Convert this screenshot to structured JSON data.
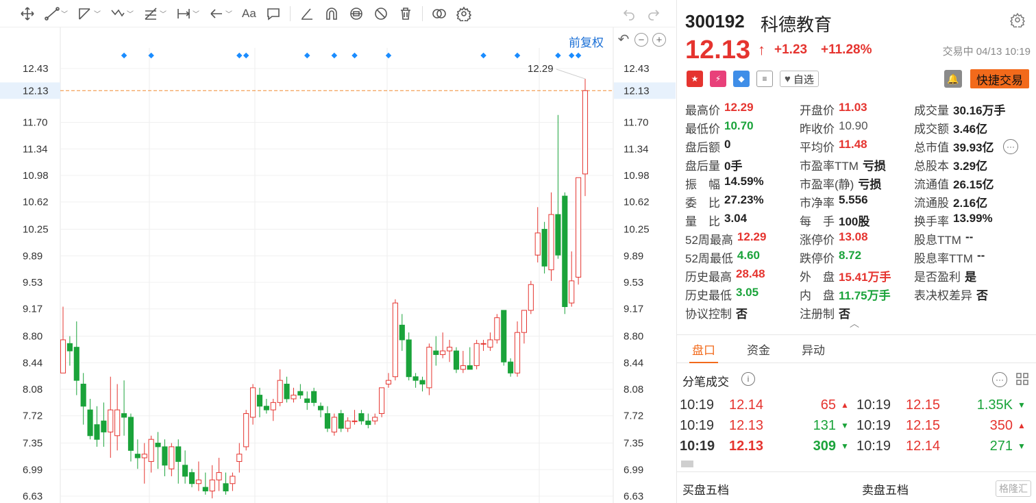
{
  "toolbar": {
    "items": [
      "move",
      "trend-line",
      "polyline",
      "wave",
      "fib",
      "measure",
      "arrow",
      "text",
      "comment",
      "pencil",
      "magnet",
      "lock",
      "hide",
      "delete",
      "compare",
      "settings"
    ],
    "text_label": "Aa"
  },
  "chart": {
    "adjust_label": "前复权",
    "y_ticks": [
      "12.43",
      "12.13",
      "11.70",
      "11.34",
      "10.98",
      "10.62",
      "10.25",
      "9.89",
      "9.53",
      "9.17",
      "8.80",
      "8.44",
      "8.08",
      "7.72",
      "7.35",
      "6.99",
      "6.63"
    ],
    "current_price_label": "12.13",
    "high_label": "12.29",
    "low_label": "6.63",
    "current_line_color": "#f08a30",
    "up_color": "#e5342f",
    "down_color": "#1aa33a",
    "marker_color": "#1a8cff"
  },
  "chart_data": {
    "type": "candlestick",
    "ylim": [
      6.63,
      12.43
    ],
    "candles": [
      {
        "o": 8.3,
        "h": 9.2,
        "l": 8.3,
        "c": 8.75
      },
      {
        "o": 8.7,
        "h": 8.8,
        "l": 8.4,
        "c": 8.6
      },
      {
        "o": 8.65,
        "h": 9.0,
        "l": 8.0,
        "c": 8.2
      },
      {
        "o": 8.15,
        "h": 8.3,
        "l": 7.6,
        "c": 7.85
      },
      {
        "o": 7.8,
        "h": 7.95,
        "l": 7.4,
        "c": 7.45
      },
      {
        "o": 7.6,
        "h": 7.85,
        "l": 7.3,
        "c": 7.4
      },
      {
        "o": 7.65,
        "h": 7.9,
        "l": 7.3,
        "c": 7.5
      },
      {
        "o": 7.5,
        "h": 8.25,
        "l": 7.15,
        "c": 7.8
      },
      {
        "o": 7.45,
        "h": 8.15,
        "l": 7.25,
        "c": 7.8
      },
      {
        "o": 7.75,
        "h": 8.2,
        "l": 7.45,
        "c": 7.7
      },
      {
        "o": 7.7,
        "h": 7.75,
        "l": 7.1,
        "c": 7.25
      },
      {
        "o": 7.2,
        "h": 7.4,
        "l": 7.0,
        "c": 7.15
      },
      {
        "o": 7.15,
        "h": 7.35,
        "l": 6.8,
        "c": 7.2
      },
      {
        "o": 7.1,
        "h": 7.45,
        "l": 6.95,
        "c": 7.4
      },
      {
        "o": 7.35,
        "h": 7.5,
        "l": 7.0,
        "c": 7.3
      },
      {
        "o": 7.3,
        "h": 7.4,
        "l": 6.9,
        "c": 7.05
      },
      {
        "o": 7.0,
        "h": 7.35,
        "l": 6.9,
        "c": 7.3
      },
      {
        "o": 7.3,
        "h": 7.4,
        "l": 6.8,
        "c": 7.1
      },
      {
        "o": 7.05,
        "h": 7.25,
        "l": 6.8,
        "c": 6.9
      },
      {
        "o": 6.95,
        "h": 7.0,
        "l": 6.75,
        "c": 6.8
      },
      {
        "o": 6.8,
        "h": 7.1,
        "l": 6.7,
        "c": 6.85
      },
      {
        "o": 6.75,
        "h": 6.95,
        "l": 6.65,
        "c": 6.7
      },
      {
        "o": 6.7,
        "h": 7.05,
        "l": 6.6,
        "c": 6.85
      },
      {
        "o": 6.85,
        "h": 7.15,
        "l": 6.7,
        "c": 6.95
      },
      {
        "o": 6.8,
        "h": 6.95,
        "l": 6.65,
        "c": 6.7
      },
      {
        "o": 6.8,
        "h": 6.95,
        "l": 6.7,
        "c": 6.9
      },
      {
        "o": 7.1,
        "h": 7.35,
        "l": 6.95,
        "c": 7.2
      },
      {
        "o": 7.3,
        "h": 7.8,
        "l": 7.25,
        "c": 7.75
      },
      {
        "o": 7.7,
        "h": 8.15,
        "l": 7.6,
        "c": 8.1
      },
      {
        "o": 8.0,
        "h": 8.1,
        "l": 7.7,
        "c": 7.85
      },
      {
        "o": 7.85,
        "h": 7.95,
        "l": 7.75,
        "c": 7.8
      },
      {
        "o": 7.8,
        "h": 7.95,
        "l": 7.65,
        "c": 7.9
      },
      {
        "o": 7.9,
        "h": 8.35,
        "l": 7.85,
        "c": 8.2
      },
      {
        "o": 8.15,
        "h": 8.25,
        "l": 7.9,
        "c": 7.95
      },
      {
        "o": 7.95,
        "h": 8.1,
        "l": 7.9,
        "c": 8.0
      },
      {
        "o": 8.05,
        "h": 8.15,
        "l": 7.95,
        "c": 8.0
      },
      {
        "o": 7.95,
        "h": 8.05,
        "l": 7.8,
        "c": 7.9
      },
      {
        "o": 8.05,
        "h": 8.1,
        "l": 7.85,
        "c": 7.9
      },
      {
        "o": 7.85,
        "h": 7.9,
        "l": 7.7,
        "c": 7.8
      },
      {
        "o": 7.75,
        "h": 7.85,
        "l": 7.5,
        "c": 7.55
      },
      {
        "o": 7.5,
        "h": 7.75,
        "l": 7.45,
        "c": 7.7
      },
      {
        "o": 7.75,
        "h": 7.8,
        "l": 7.5,
        "c": 7.55
      },
      {
        "o": 7.55,
        "h": 7.7,
        "l": 7.5,
        "c": 7.65
      },
      {
        "o": 7.65,
        "h": 7.8,
        "l": 7.6,
        "c": 7.65
      },
      {
        "o": 7.75,
        "h": 7.8,
        "l": 7.6,
        "c": 7.65
      },
      {
        "o": 7.65,
        "h": 7.75,
        "l": 7.55,
        "c": 7.6
      },
      {
        "o": 7.65,
        "h": 7.75,
        "l": 7.6,
        "c": 7.7
      },
      {
        "o": 7.75,
        "h": 8.1,
        "l": 7.7,
        "c": 8.1
      },
      {
        "o": 8.15,
        "h": 8.3,
        "l": 8.1,
        "c": 8.2
      },
      {
        "o": 8.25,
        "h": 9.3,
        "l": 8.2,
        "c": 9.25
      },
      {
        "o": 8.95,
        "h": 9.1,
        "l": 8.6,
        "c": 8.75
      },
      {
        "o": 8.75,
        "h": 8.85,
        "l": 8.2,
        "c": 8.25
      },
      {
        "o": 8.25,
        "h": 8.3,
        "l": 8.1,
        "c": 8.2
      },
      {
        "o": 8.2,
        "h": 8.25,
        "l": 8.05,
        "c": 8.15
      },
      {
        "o": 8.1,
        "h": 8.7,
        "l": 8.0,
        "c": 8.65
      },
      {
        "o": 8.6,
        "h": 8.8,
        "l": 8.4,
        "c": 8.55
      },
      {
        "o": 8.55,
        "h": 8.85,
        "l": 8.5,
        "c": 8.6
      },
      {
        "o": 8.6,
        "h": 8.75,
        "l": 8.45,
        "c": 8.65
      },
      {
        "o": 8.6,
        "h": 8.65,
        "l": 8.3,
        "c": 8.35
      },
      {
        "o": 8.35,
        "h": 8.6,
        "l": 8.3,
        "c": 8.4
      },
      {
        "o": 8.4,
        "h": 8.65,
        "l": 8.35,
        "c": 8.35
      },
      {
        "o": 8.4,
        "h": 8.75,
        "l": 8.35,
        "c": 8.7
      },
      {
        "o": 8.7,
        "h": 8.75,
        "l": 8.6,
        "c": 8.7
      },
      {
        "o": 8.65,
        "h": 8.85,
        "l": 8.6,
        "c": 8.75
      },
      {
        "o": 8.75,
        "h": 9.1,
        "l": 8.7,
        "c": 9.05
      },
      {
        "o": 9.15,
        "h": 9.15,
        "l": 8.4,
        "c": 8.45
      },
      {
        "o": 8.45,
        "h": 8.5,
        "l": 8.25,
        "c": 8.3
      },
      {
        "o": 8.3,
        "h": 9.0,
        "l": 8.25,
        "c": 8.85
      },
      {
        "o": 8.85,
        "h": 9.15,
        "l": 8.7,
        "c": 9.15
      },
      {
        "o": 9.15,
        "h": 9.55,
        "l": 9.1,
        "c": 9.5
      },
      {
        "o": 9.9,
        "h": 10.55,
        "l": 9.8,
        "c": 10.2
      },
      {
        "o": 10.25,
        "h": 10.35,
        "l": 9.65,
        "c": 9.75
      },
      {
        "o": 9.7,
        "h": 10.75,
        "l": 9.55,
        "c": 10.45
      },
      {
        "o": 10.45,
        "h": 11.8,
        "l": 9.85,
        "c": 9.9
      },
      {
        "o": 10.7,
        "h": 10.75,
        "l": 9.1,
        "c": 9.2
      },
      {
        "o": 9.25,
        "h": 9.95,
        "l": 9.2,
        "c": 9.55
      },
      {
        "o": 9.6,
        "h": 10.95,
        "l": 9.5,
        "c": 10.95
      },
      {
        "o": 11.0,
        "h": 12.29,
        "l": 10.7,
        "c": 12.13
      }
    ],
    "markers_x_index": [
      9,
      13,
      26,
      27,
      36,
      40,
      43,
      48,
      62,
      67,
      73,
      75,
      76
    ]
  },
  "stock": {
    "code": "300192",
    "name": "科德教育",
    "price": "12.13",
    "arrow": "↑",
    "change": "+1.23",
    "change_pct": "+11.28%",
    "status": "交易中 04/13 10:19",
    "watch_label": "自选",
    "quick_trade": "快捷交易"
  },
  "stats": [
    [
      {
        "l": "最高价",
        "v": "12.29",
        "c": "red"
      },
      {
        "l": "开盘价",
        "v": "11.03",
        "c": "red"
      },
      {
        "l": "成交量",
        "v": "30.16万手",
        "c": "dark"
      }
    ],
    [
      {
        "l": "最低价",
        "v": "10.70",
        "c": "green"
      },
      {
        "l": "昨收价",
        "v": "10.90",
        "c": "gray"
      },
      {
        "l": "成交额",
        "v": "3.46亿",
        "c": "dark"
      }
    ],
    [
      {
        "l": "盘后额",
        "v": "0",
        "c": "dark"
      },
      {
        "l": "平均价",
        "v": "11.48",
        "c": "red"
      },
      {
        "l": "总市值",
        "v": "39.93亿",
        "c": "dark"
      }
    ],
    [
      {
        "l": "盘后量",
        "v": "0手",
        "c": "dark"
      },
      {
        "l": "市盈率TTM",
        "v": "亏损",
        "c": "dark"
      },
      {
        "l": "总股本",
        "v": "3.29亿",
        "c": "dark"
      }
    ],
    [
      {
        "l": "振　幅",
        "v": "14.59%",
        "c": "dark"
      },
      {
        "l": "市盈率(静)",
        "v": "亏损",
        "c": "dark"
      },
      {
        "l": "流通值",
        "v": "26.15亿",
        "c": "dark"
      }
    ],
    [
      {
        "l": "委　比",
        "v": "27.23%",
        "c": "dark"
      },
      {
        "l": "市净率",
        "v": "5.556",
        "c": "dark"
      },
      {
        "l": "流通股",
        "v": "2.16亿",
        "c": "dark"
      }
    ],
    [
      {
        "l": "量　比",
        "v": "3.04",
        "c": "dark"
      },
      {
        "l": "每　手",
        "v": "100股",
        "c": "dark"
      },
      {
        "l": "换手率",
        "v": "13.99%",
        "c": "dark"
      }
    ],
    [
      {
        "l": "52周最高",
        "v": "12.29",
        "c": "red"
      },
      {
        "l": "涨停价",
        "v": "13.08",
        "c": "red"
      },
      {
        "l": "股息TTM",
        "v": "--",
        "c": "dark"
      }
    ],
    [
      {
        "l": "52周最低",
        "v": "4.60",
        "c": "green"
      },
      {
        "l": "跌停价",
        "v": "8.72",
        "c": "green"
      },
      {
        "l": "股息率TTM",
        "v": "--",
        "c": "dark"
      }
    ],
    [
      {
        "l": "历史最高",
        "v": "28.48",
        "c": "red"
      },
      {
        "l": "外　盘",
        "v": "15.41万手",
        "c": "red"
      },
      {
        "l": "是否盈利",
        "v": "是",
        "c": "dark"
      }
    ],
    [
      {
        "l": "历史最低",
        "v": "3.05",
        "c": "green"
      },
      {
        "l": "内　盘",
        "v": "11.75万手",
        "c": "green"
      },
      {
        "l": "表决权差异",
        "v": "否",
        "c": "dark"
      }
    ],
    [
      {
        "l": "协议控制",
        "v": "否",
        "c": "dark"
      },
      {
        "l": "注册制",
        "v": "否",
        "c": "dark"
      },
      {
        "l": "",
        "v": "",
        "c": "dark"
      }
    ]
  ],
  "tabs": [
    "盘口",
    "资金",
    "异动"
  ],
  "ticks": {
    "title": "分笔成交",
    "rows": [
      [
        {
          "t": "10:19",
          "p": "12.14",
          "v": "65",
          "vc": "red",
          "a": "up"
        },
        {
          "t": "10:19",
          "p": "12.15",
          "v": "1.35K",
          "vc": "green",
          "a": "down"
        }
      ],
      [
        {
          "t": "10:19",
          "p": "12.13",
          "v": "131",
          "vc": "green",
          "a": "down"
        },
        {
          "t": "10:19",
          "p": "12.15",
          "v": "350",
          "vc": "red",
          "a": "up"
        }
      ],
      [
        {
          "t": "10:19",
          "p": "12.13",
          "v": "309",
          "vc": "green",
          "a": "down",
          "bold": true
        },
        {
          "t": "10:19",
          "p": "12.14",
          "v": "271",
          "vc": "green",
          "a": "down"
        }
      ]
    ]
  },
  "book": {
    "buy": "买盘五档",
    "sell": "卖盘五档",
    "watermark": "格隆汇"
  }
}
